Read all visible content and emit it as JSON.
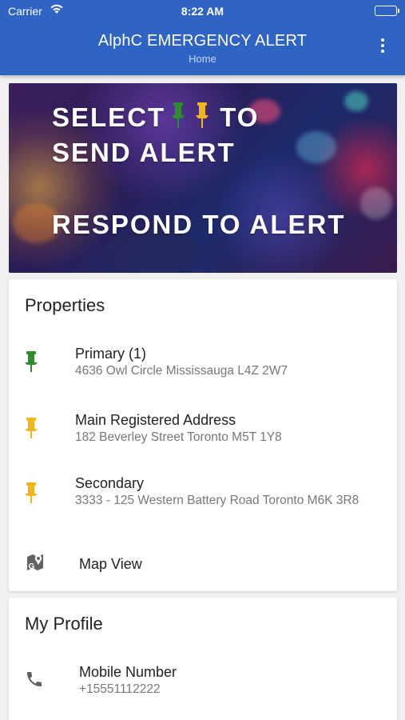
{
  "status": {
    "carrier": "Carrier",
    "time": "8:22 AM"
  },
  "header": {
    "title": "AlphC EMERGENCY ALERT",
    "subtitle": "Home"
  },
  "banner": {
    "line1a": "SELECT",
    "line1b": "TO",
    "line2": "SEND ALERT",
    "line3": "RESPOND TO ALERT"
  },
  "colors": {
    "app_bar": "#2f63c4",
    "pin_green": "#2e8b2e",
    "pin_yellow": "#f2b51d"
  },
  "properties": {
    "title": "Properties",
    "items": [
      {
        "name": "Primary (1)",
        "address": "4636 Owl Circle Mississauga   L4Z 2W7",
        "icon": "pin-green-icon"
      },
      {
        "name": "Main Registered  Address",
        "address": "182 Beverley Street Toronto   M5T 1Y8",
        "icon": "pin-yellow-icon"
      },
      {
        "name": "Secondary",
        "address": "3333 - 125 Western Battery Road Toronto   M6K 3R8",
        "icon": "pin-yellow-icon"
      }
    ],
    "map_view": "Map View"
  },
  "profile": {
    "title": "My Profile",
    "mobile_label": "Mobile Number",
    "mobile_value": "+15551112222"
  }
}
